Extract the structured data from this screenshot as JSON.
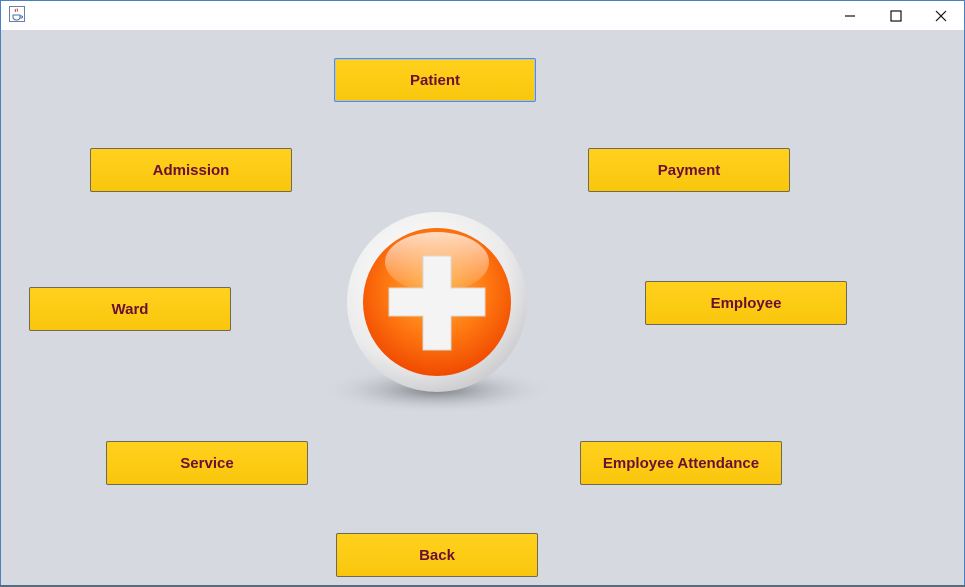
{
  "window": {
    "app_icon": "java-cup-icon",
    "controls": {
      "minimize": "minimize-icon",
      "maximize": "maximize-icon",
      "close": "close-icon"
    }
  },
  "menu": {
    "patient": "Patient",
    "admission": "Admission",
    "payment": "Payment",
    "ward": "Ward",
    "employee": "Employee",
    "service": "Service",
    "employee_attendance": "Employee Attendance",
    "back": "Back"
  },
  "emblem": {
    "icon": "medical-cross-icon"
  },
  "colors": {
    "background": "#d6d9e0",
    "button": "#fccf18",
    "button_text": "#6b0f33",
    "emblem_orange": "#ff6a00"
  }
}
